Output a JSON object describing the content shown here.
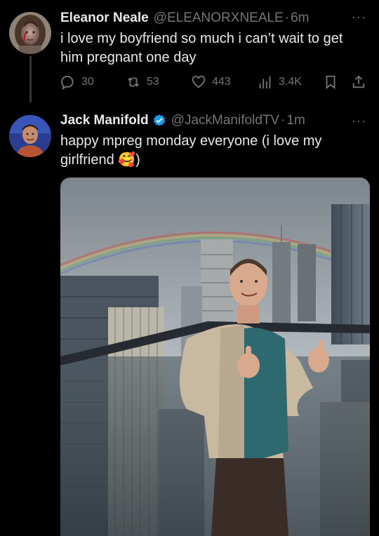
{
  "first_tweet": {
    "author_name": "Eleanor Neale",
    "handle": "@ELEANORXNEALE",
    "separator": "·",
    "time": "6m",
    "text": "i love my boyfriend so much i can’t wait to get him pregnant one day",
    "more_label": "···",
    "actions": {
      "replies": "30",
      "retweets": "53",
      "likes": "443",
      "views": "3.4K"
    }
  },
  "second_tweet": {
    "author_name": "Jack Manifold",
    "handle": "@JackManifoldTV",
    "separator": "·",
    "time": "1m",
    "text_before_emoji": "happy mpreg monday everyone (i love my girlfriend ",
    "emoji": "🥰",
    "text_after_emoji": ")",
    "more_label": "···",
    "verified": true
  },
  "colors": {
    "background": "#000000",
    "primary_text": "#e7e9ea",
    "secondary_text": "#71767b",
    "verified_blue": "#1d9bf0"
  },
  "icons": {
    "reply": "speech-bubble-icon",
    "retweet": "retweet-arrows-icon",
    "like": "heart-outline-icon",
    "views": "bar-chart-icon",
    "bookmark": "bookmark-icon",
    "share": "share-upload-icon",
    "verified": "verified-badge-icon"
  }
}
